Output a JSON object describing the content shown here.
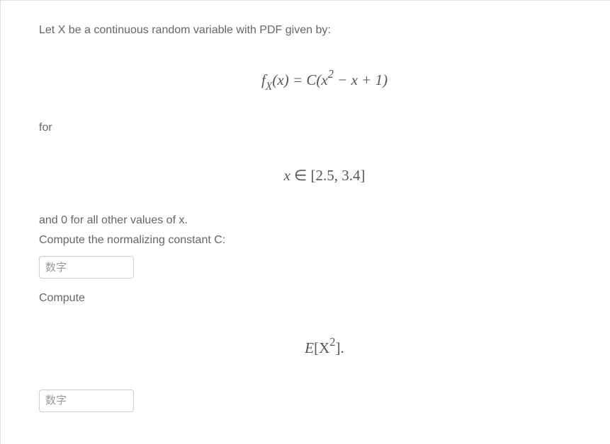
{
  "problem": {
    "intro": "Let X be a continuous random variable with PDF given by:",
    "for_text": "for",
    "and_zero": "and 0 for all other values of x.",
    "compute_c": "Compute the normalizing constant C:",
    "compute": "Compute",
    "input_placeholder": "数字"
  },
  "formulas": {
    "pdf": {
      "f": "f",
      "sub": "X",
      "open": "(x) = C(x",
      "sup": "2",
      "rest": " − x + 1)"
    },
    "domain": {
      "left": "x ∈ [2.5, 3.4]"
    },
    "expectation": {
      "E": "E",
      "open": "[X",
      "sup": "2",
      "close": "]."
    }
  }
}
